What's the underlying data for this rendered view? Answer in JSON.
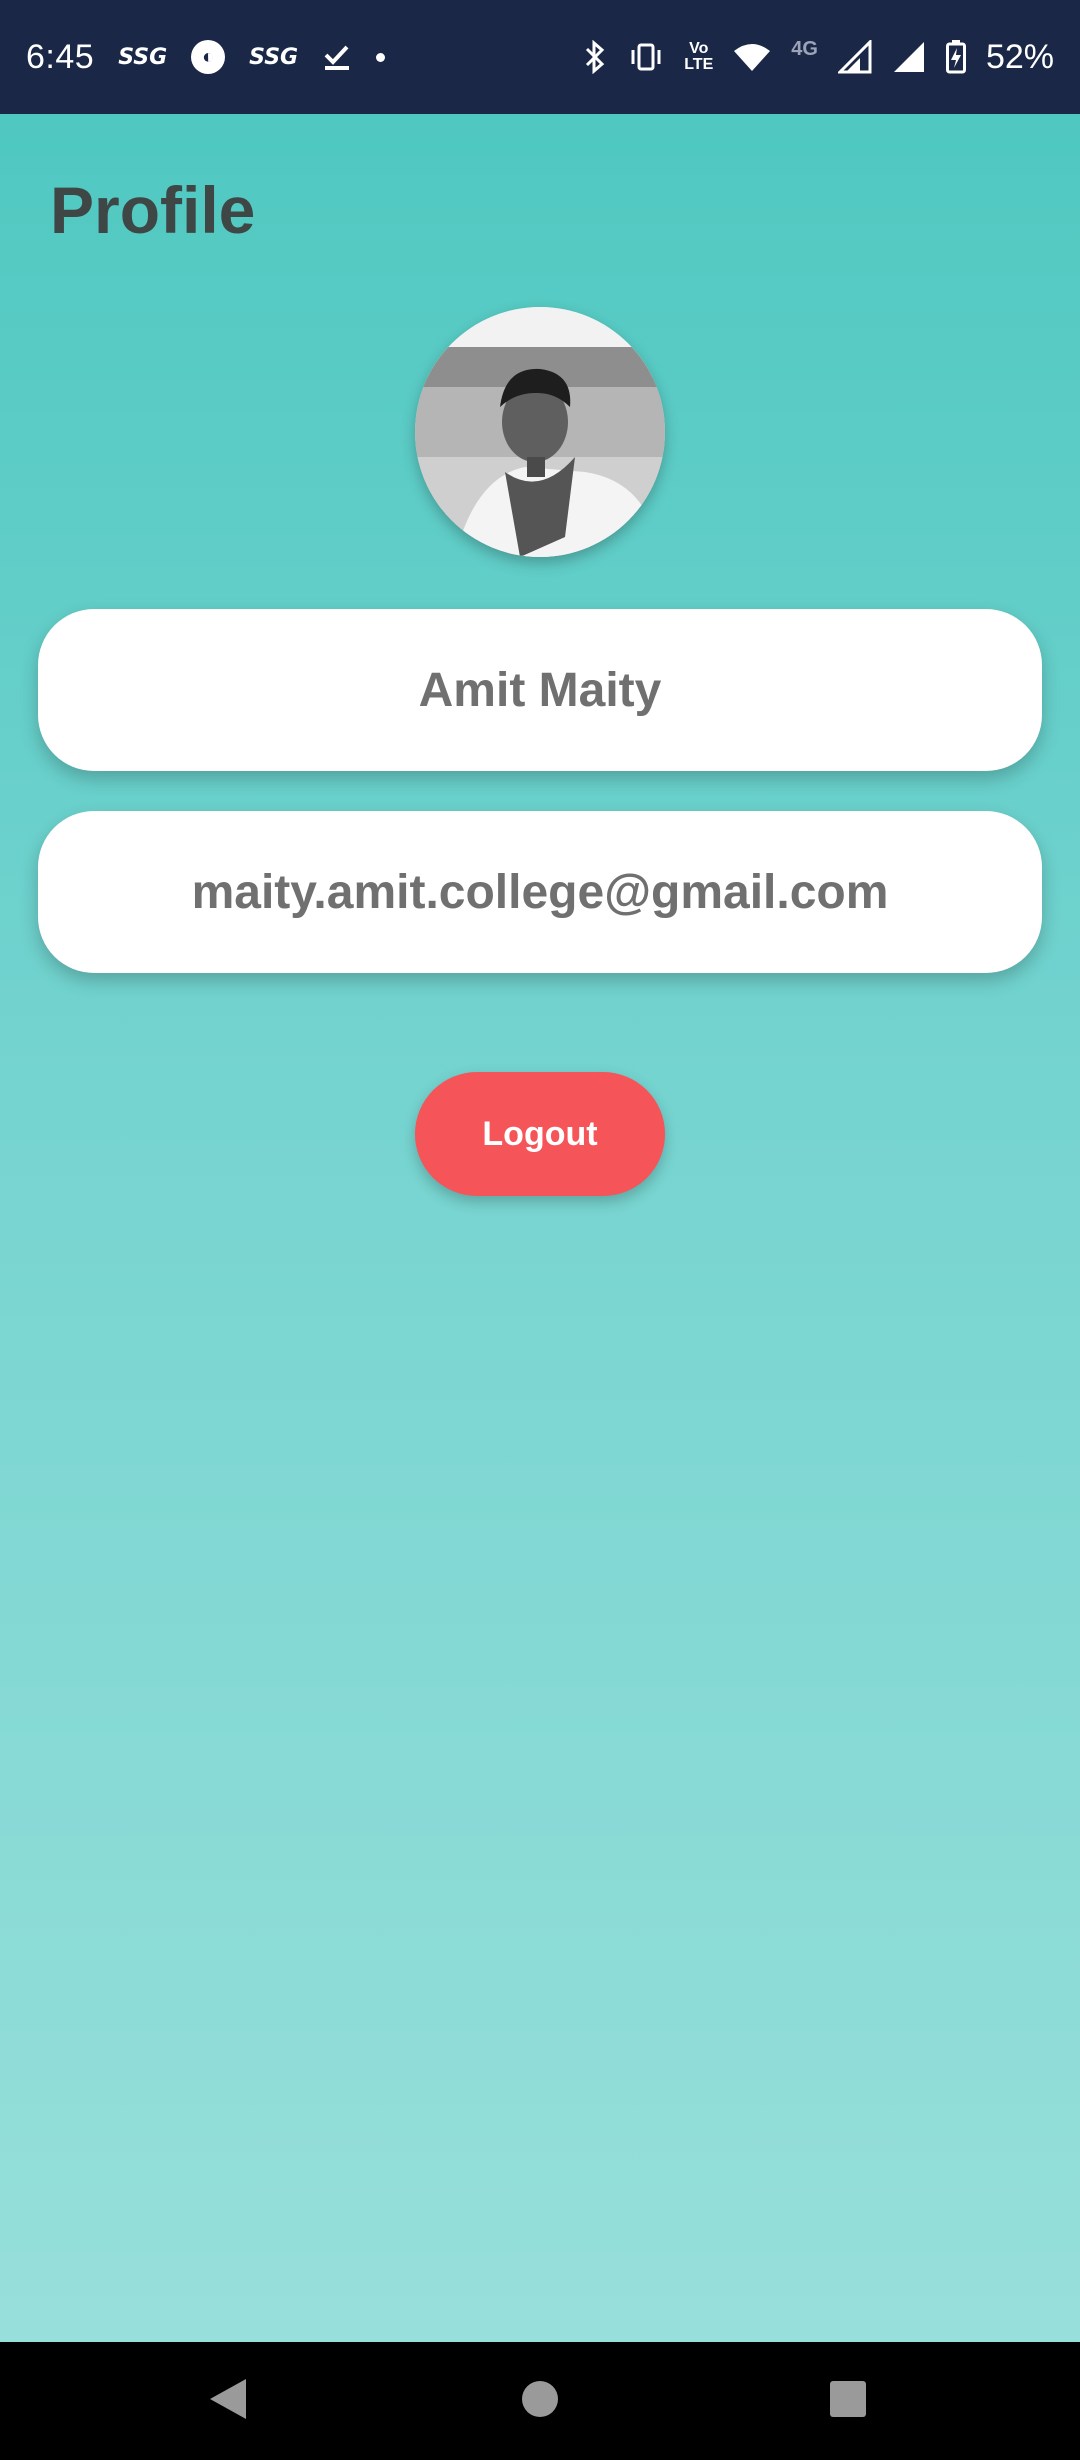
{
  "status_bar": {
    "time": "6:45",
    "app_icons": [
      "SSG",
      "SSG"
    ],
    "volte_line1": "Vo",
    "volte_line2": "LTE",
    "network_type": "4G",
    "roaming": "R",
    "battery_percent": "52%"
  },
  "profile": {
    "title": "Profile",
    "name": "Amit Maity",
    "email": "maity.amit.college@gmail.com",
    "logout_label": "Logout"
  },
  "colors": {
    "status_bar_bg": "#1a2747",
    "gradient_top": "#4fc8c1",
    "gradient_bottom": "#97dfda",
    "logout_bg": "#f55458",
    "title_text": "#3f4646",
    "card_text": "#707070"
  },
  "icons": {
    "status": [
      "ssg-app-icon",
      "circle-app-icon",
      "ssg-app-icon",
      "check-icon",
      "dot-icon",
      "bluetooth-icon",
      "vibrate-icon",
      "volte-icon",
      "wifi-icon",
      "signal-icon",
      "signal-icon",
      "battery-charging-icon"
    ],
    "nav": [
      "back-icon",
      "home-icon",
      "recents-icon"
    ]
  }
}
